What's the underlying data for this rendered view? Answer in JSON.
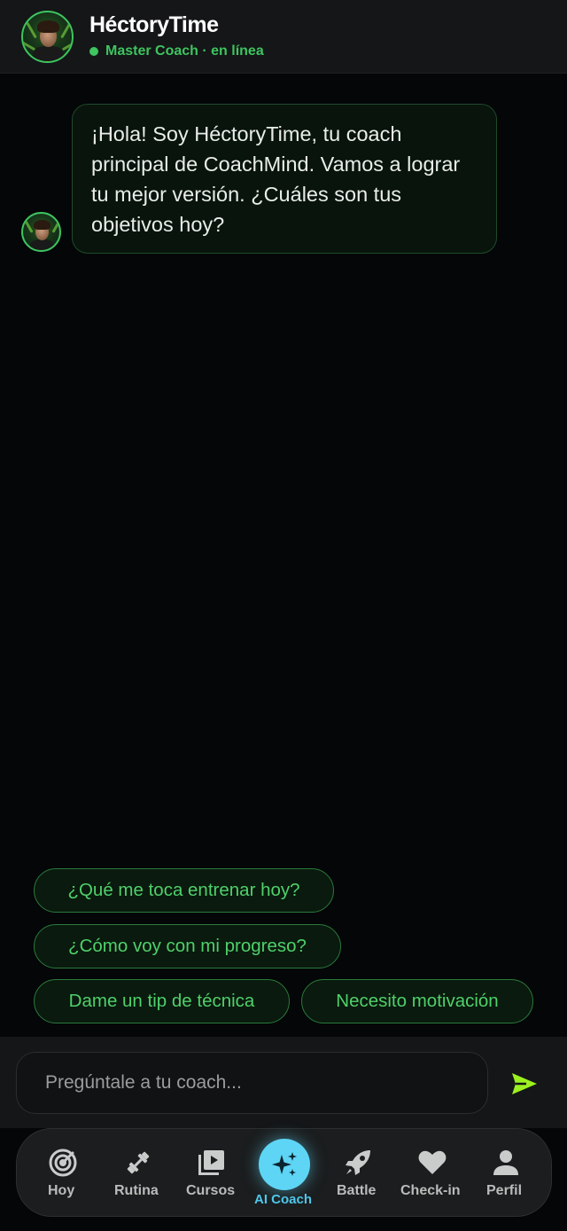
{
  "header": {
    "title": "HéctoryTime",
    "status": "Master Coach · en línea"
  },
  "message": {
    "text": "¡Hola! Soy HéctoryTime, tu coach principal de CoachMind. Vamos a lograr tu mejor versión. ¿Cuáles son tus objetivos hoy?"
  },
  "suggestions": [
    "¿Qué me toca entrenar hoy?",
    "¿Cómo voy con mi progreso?",
    "Dame un tip de técnica",
    "Necesito motivación"
  ],
  "input": {
    "placeholder": "Pregúntale a tu coach..."
  },
  "nav": {
    "items": [
      {
        "label": "Hoy",
        "icon": "target-icon"
      },
      {
        "label": "Rutina",
        "icon": "dumbbell-icon"
      },
      {
        "label": "Cursos",
        "icon": "video-library-icon"
      },
      {
        "label": "AI Coach",
        "icon": "sparkles-icon",
        "active": true
      },
      {
        "label": "Battle",
        "icon": "rocket-icon"
      },
      {
        "label": "Check-in",
        "icon": "heart-icon"
      },
      {
        "label": "Perfil",
        "icon": "person-icon"
      }
    ]
  },
  "colors": {
    "accent": "#3ec460",
    "active_nav": "#5ed5f5",
    "send": "#9cf020"
  }
}
